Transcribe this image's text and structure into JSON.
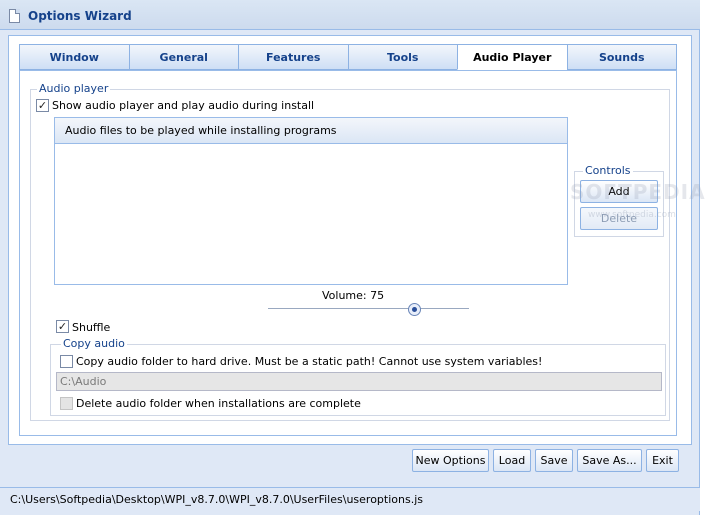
{
  "window": {
    "title": "Options Wizard"
  },
  "tabs": [
    {
      "label": "Window",
      "active": false
    },
    {
      "label": "General",
      "active": false
    },
    {
      "label": "Features",
      "active": false
    },
    {
      "label": "Tools",
      "active": false
    },
    {
      "label": "Audio Player",
      "active": true
    },
    {
      "label": "Sounds",
      "active": false
    }
  ],
  "audio_player": {
    "legend": "Audio player",
    "show_player_label": "Show audio player and play audio during install",
    "show_player_checked": true,
    "list_header": "Audio files to be played while installing programs",
    "controls_legend": "Controls",
    "add_label": "Add",
    "delete_label": "Delete",
    "volume_label": "Volume: 75",
    "volume_value": 75,
    "shuffle_label": "Shuffle",
    "shuffle_checked": true
  },
  "copy_audio": {
    "legend": "Copy audio",
    "copy_label": "Copy audio folder to hard drive. Must be a static path! Cannot use system variables!",
    "copy_checked": false,
    "path_value": "C:\\Audio",
    "delete_label": "Delete audio folder when installations are complete",
    "delete_checked": false
  },
  "buttons": {
    "new_options": "New Options",
    "load": "Load",
    "save": "Save",
    "save_as": "Save As...",
    "exit": "Exit"
  },
  "status": {
    "path": "C:\\Users\\Softpedia\\Desktop\\WPI_v8.7.0\\WPI_v8.7.0\\UserFiles\\useroptions.js"
  },
  "watermark": {
    "brand": "SOFTPEDIA",
    "url": "www.softpedia.com"
  },
  "colors": {
    "accent": "#15428b",
    "border": "#99bbe8",
    "panel": "#dfe8f6"
  }
}
